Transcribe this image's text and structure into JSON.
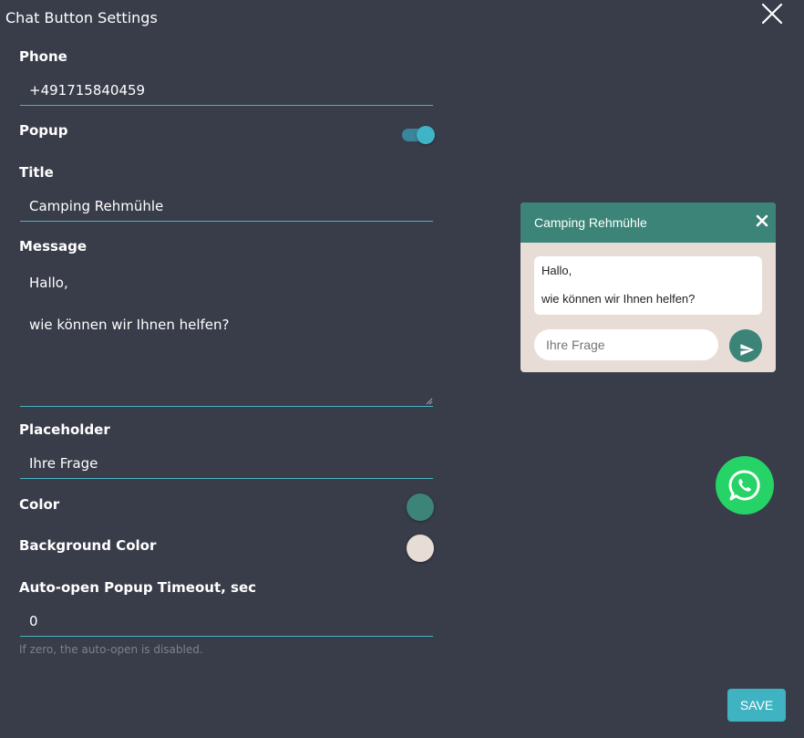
{
  "dialog": {
    "title": "Chat Button Settings",
    "close_icon": "close-icon"
  },
  "fields": {
    "phone": {
      "label": "Phone",
      "value": "+491715840459"
    },
    "popup": {
      "label": "Popup",
      "enabled": true
    },
    "title": {
      "label": "Title",
      "value": "Camping Rehmühle"
    },
    "message": {
      "label": "Message",
      "value": "Hallo,\n\nwie können wir Ihnen helfen?"
    },
    "placeholder": {
      "label": "Placeholder",
      "value": "Ihre Frage"
    },
    "color": {
      "label": "Color",
      "value": "#3b8477"
    },
    "background_color": {
      "label": "Background Color",
      "value": "#e8ddd6"
    },
    "auto_open": {
      "label": "Auto-open Popup Timeout, sec",
      "value": "0",
      "hint": "If zero, the auto-open is disabled."
    }
  },
  "save_label": "SAVE",
  "preview": {
    "title": "Camping Rehmühle",
    "message_line1": "Hallo,",
    "message_line2": "wie können wir Ihnen helfen?",
    "input_placeholder": "Ihre Frage",
    "send_icon": "send-icon",
    "whatsapp_icon": "whatsapp-icon"
  },
  "colors": {
    "background": "#393d4a",
    "accent": "#3fb3c2",
    "whatsapp": "#25d366"
  }
}
